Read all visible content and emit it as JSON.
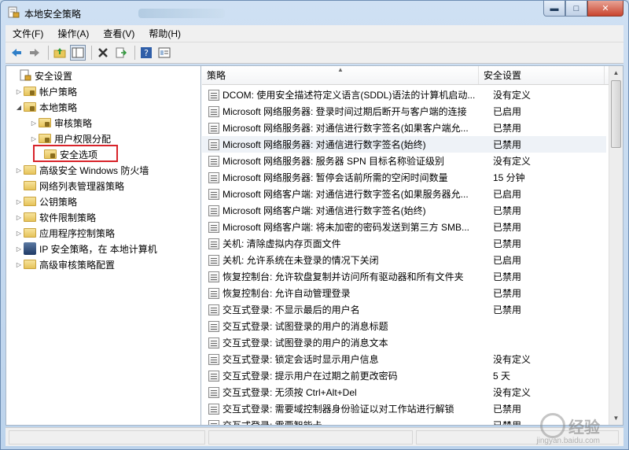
{
  "window": {
    "title": "本地安全策略"
  },
  "menu": {
    "items": [
      "文件(F)",
      "操作(A)",
      "查看(V)",
      "帮助(H)"
    ]
  },
  "toolbar": {
    "icons": [
      "back-arrow-icon",
      "forward-arrow-icon",
      "up-folder-icon",
      "show-hide-tree-icon",
      "delete-icon",
      "export-list-icon",
      "help-icon",
      "properties-icon"
    ]
  },
  "tree": {
    "root": "安全设置",
    "account_policy": "帐户策略",
    "local_policy": "本地策略",
    "audit_policy": "审核策略",
    "user_rights": "用户权限分配",
    "security_options": "安全选项",
    "firewall": "高级安全 Windows 防火墙",
    "network_list": "网络列表管理器策略",
    "public_key": "公钥策略",
    "software_restriction": "软件限制策略",
    "app_control": "应用程序控制策略",
    "ipsec": "IP 安全策略，在 本地计算机",
    "advanced_audit": "高级审核策略配置"
  },
  "list": {
    "columns": {
      "policy": "策略",
      "setting": "安全设置"
    },
    "rows": [
      {
        "policy": "DCOM: 使用安全描述符定义语言(SDDL)语法的计算机启动...",
        "setting": "没有定义"
      },
      {
        "policy": "Microsoft 网络服务器: 登录时间过期后断开与客户端的连接",
        "setting": "已启用"
      },
      {
        "policy": "Microsoft 网络服务器: 对通信进行数字签名(如果客户端允...",
        "setting": "已禁用"
      },
      {
        "policy": "Microsoft 网络服务器: 对通信进行数字签名(始终)",
        "setting": "已禁用"
      },
      {
        "policy": "Microsoft 网络服务器: 服务器 SPN 目标名称验证级别",
        "setting": "没有定义"
      },
      {
        "policy": "Microsoft 网络服务器: 暂停会话前所需的空闲时间数量",
        "setting": "15 分钟"
      },
      {
        "policy": "Microsoft 网络客户端: 对通信进行数字签名(如果服务器允...",
        "setting": "已启用"
      },
      {
        "policy": "Microsoft 网络客户端: 对通信进行数字签名(始终)",
        "setting": "已禁用"
      },
      {
        "policy": "Microsoft 网络客户端: 将未加密的密码发送到第三方 SMB...",
        "setting": "已禁用"
      },
      {
        "policy": "关机: 清除虚拟内存页面文件",
        "setting": "已禁用"
      },
      {
        "policy": "关机: 允许系统在未登录的情况下关闭",
        "setting": "已启用"
      },
      {
        "policy": "恢复控制台: 允许软盘复制并访问所有驱动器和所有文件夹",
        "setting": "已禁用"
      },
      {
        "policy": "恢复控制台: 允许自动管理登录",
        "setting": "已禁用"
      },
      {
        "policy": "交互式登录: 不显示最后的用户名",
        "setting": "已禁用"
      },
      {
        "policy": "交互式登录: 试图登录的用户的消息标题",
        "setting": ""
      },
      {
        "policy": "交互式登录: 试图登录的用户的消息文本",
        "setting": ""
      },
      {
        "policy": "交互式登录: 锁定会话时显示用户信息",
        "setting": "没有定义"
      },
      {
        "policy": "交互式登录: 提示用户在过期之前更改密码",
        "setting": "5 天"
      },
      {
        "policy": "交互式登录: 无须按 Ctrl+Alt+Del",
        "setting": "没有定义"
      },
      {
        "policy": "交互式登录: 需要域控制器身份验证以对工作站进行解锁",
        "setting": "已禁用"
      },
      {
        "policy": "交互式登录: 需要智能卡",
        "setting": "已禁用"
      }
    ]
  },
  "watermark": {
    "text": "经验",
    "sub": "jingyan.baidu.com"
  }
}
